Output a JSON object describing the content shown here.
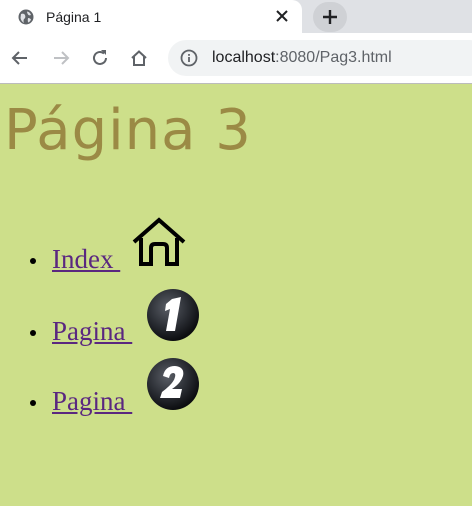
{
  "browser": {
    "tab": {
      "title": "Página 1",
      "favicon": "globe-icon",
      "close_label": "✕"
    },
    "new_tab_label": "+",
    "address": {
      "host": "localhost",
      "port_path": ":8080/Pag3.html"
    }
  },
  "page": {
    "heading": "Página 3",
    "background": "#cddf8a",
    "heading_color": "#9b8a45",
    "link_color": "#5a2780",
    "links": [
      {
        "label": "Index ",
        "icon": "home-icon"
      },
      {
        "label": "Pagina ",
        "icon": "number-one-icon",
        "icon_text": "1"
      },
      {
        "label": "Pagina ",
        "icon": "number-two-icon",
        "icon_text": "2"
      }
    ]
  }
}
